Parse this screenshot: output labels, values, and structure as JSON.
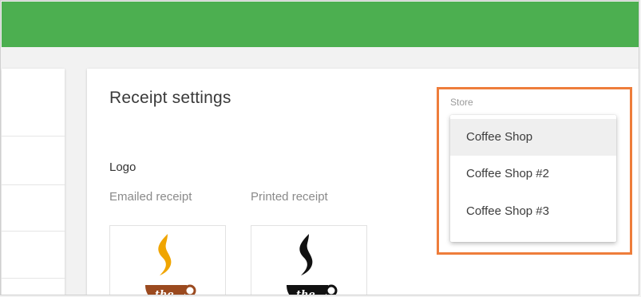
{
  "page": {
    "title": "Receipt settings"
  },
  "logo_section": {
    "heading": "Logo",
    "emailed_label": "Emailed receipt",
    "printed_label": "Printed receipt",
    "emailed_logo_text": "the",
    "printed_logo_text": "the"
  },
  "store": {
    "label": "Store",
    "options": [
      "Coffee Shop",
      "Coffee Shop #2",
      "Coffee Shop #3"
    ],
    "selected_index": 0
  },
  "colors": {
    "header": "#4caf50",
    "highlight": "#ee7d3b",
    "logo_emailed_flame": "#f0a500",
    "logo_emailed_cup": "#9b4a1f",
    "logo_printed": "#111111"
  }
}
